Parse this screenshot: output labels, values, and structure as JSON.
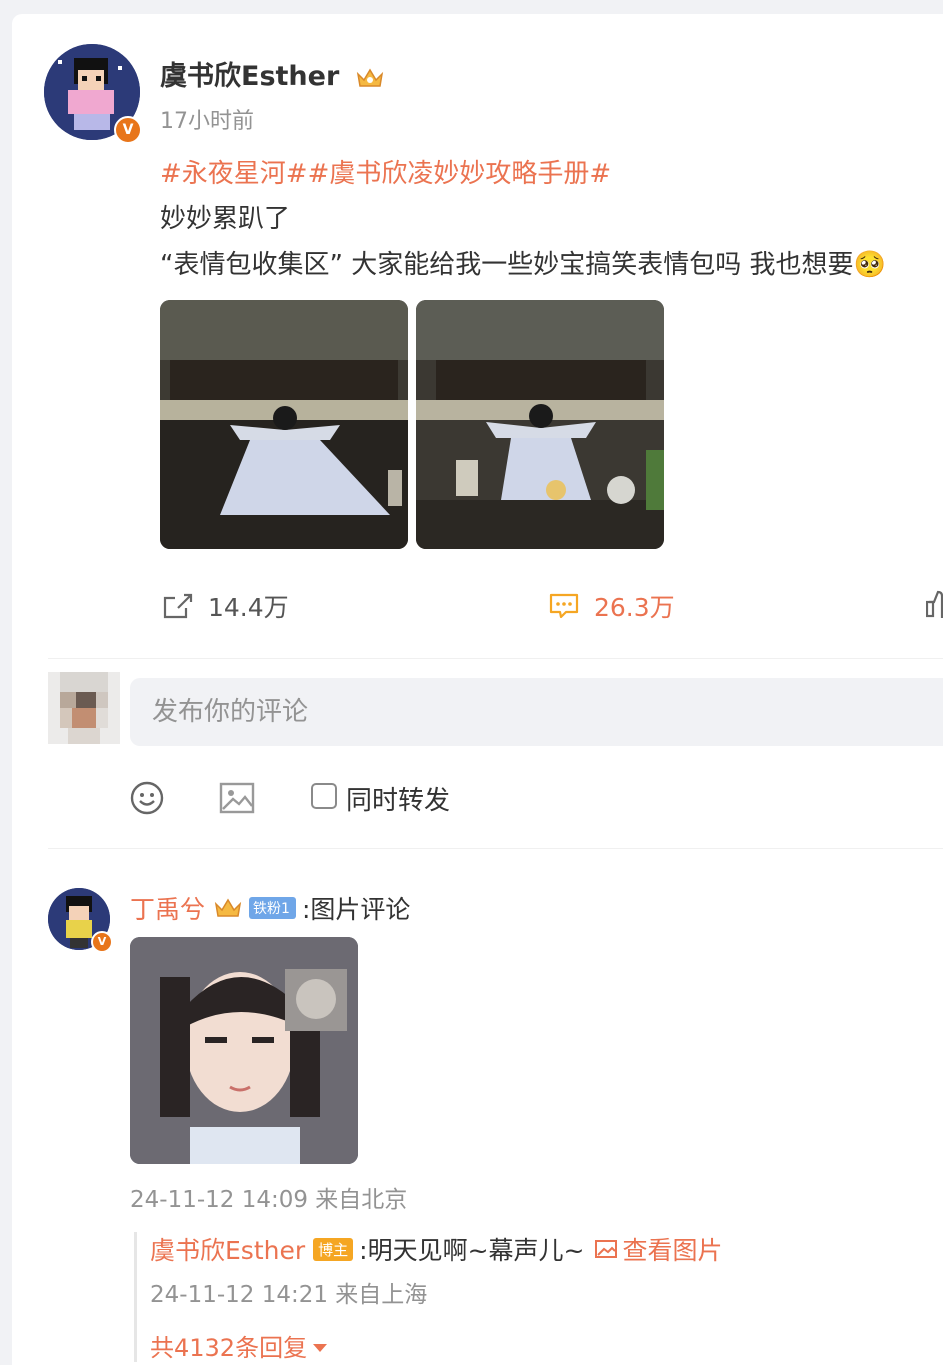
{
  "post": {
    "author": "虞书欣Esther",
    "time": "17小时前",
    "topics": "#永夜星河##虞书欣凌妙妙攻略手册#",
    "text_line1": "妙妙累趴了",
    "text_line2": "“表情包收集区” 大家能给我一些妙宝搞笑表情包吗 我也想要🥺",
    "repost_count": "14.4万",
    "comment_count": "26.3万"
  },
  "composer": {
    "placeholder": "发布你的评论",
    "repost_label": "同时转发"
  },
  "comment": {
    "author": "丁禹兮",
    "fan_badge": "铁粉1",
    "text": ":图片评论",
    "time": "24-11-12 14:09 来自北京"
  },
  "reply": {
    "author": "虞书欣Esther",
    "badge": "博主",
    "text": ":明天见啊~幕声儿~",
    "view_image": "查看图片",
    "time": "24-11-12 14:21 来自上海"
  },
  "more_replies": "共4132条回复",
  "colors": {
    "accent": "#eb7350",
    "comment_icon": "#f5a623",
    "muted": "#939393"
  }
}
